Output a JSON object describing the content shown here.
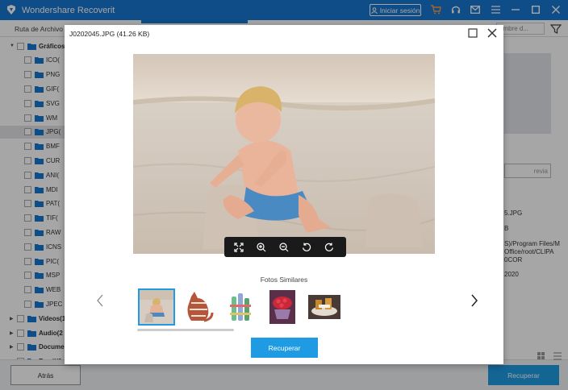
{
  "app": {
    "title": "Wondershare Recoverit",
    "login_label": "Iniciar sesión",
    "colors": {
      "brand": "#1677d2",
      "accent": "#1e9be3"
    }
  },
  "toolbar_icons": [
    "cart-icon",
    "headset-icon",
    "mail-icon",
    "menu-icon",
    "minimize-icon",
    "maximize-icon",
    "close-icon"
  ],
  "background": {
    "tab_ruta": "Ruta de Archivo",
    "search_placeholder": "ombre d...",
    "tree": {
      "root": "Gráficos",
      "items": [
        "ICO(",
        "PNG",
        "GIF(",
        "SVG",
        "WM",
        "JPG(",
        "BMF",
        "CUR",
        "ANI(",
        "MDI",
        "PAT(",
        "TIF(",
        "RAW",
        "ICNS",
        "PIC(",
        "MSP",
        "WEB",
        "JPEC"
      ],
      "selected_index": 5,
      "groups": [
        "Videos(1",
        "Audio(2",
        "Docume",
        "Email(2"
      ]
    },
    "right_pane": {
      "preview_button": "revia",
      "lines": [
        "5.JPG",
        "B",
        "S)/Program Files/M",
        "Office/root/CLIPA",
        "0COR",
        "2020"
      ]
    },
    "back_button": "Atrás",
    "recover_button": "Recuperar"
  },
  "modal": {
    "title": "J0202045.JPG (41.26 KB)",
    "similar_label": "Fotos Similares",
    "recover_button": "Recuperar",
    "controls": [
      "fit-screen-icon",
      "zoom-in-icon",
      "zoom-out-icon",
      "rotate-left-icon",
      "rotate-right-icon"
    ],
    "thumbnails": [
      "beach-child-thumbnail",
      "cat-figurine-thumbnail",
      "bottles-thumbnail",
      "berries-thumbnail",
      "food-plate-thumbnail"
    ]
  }
}
